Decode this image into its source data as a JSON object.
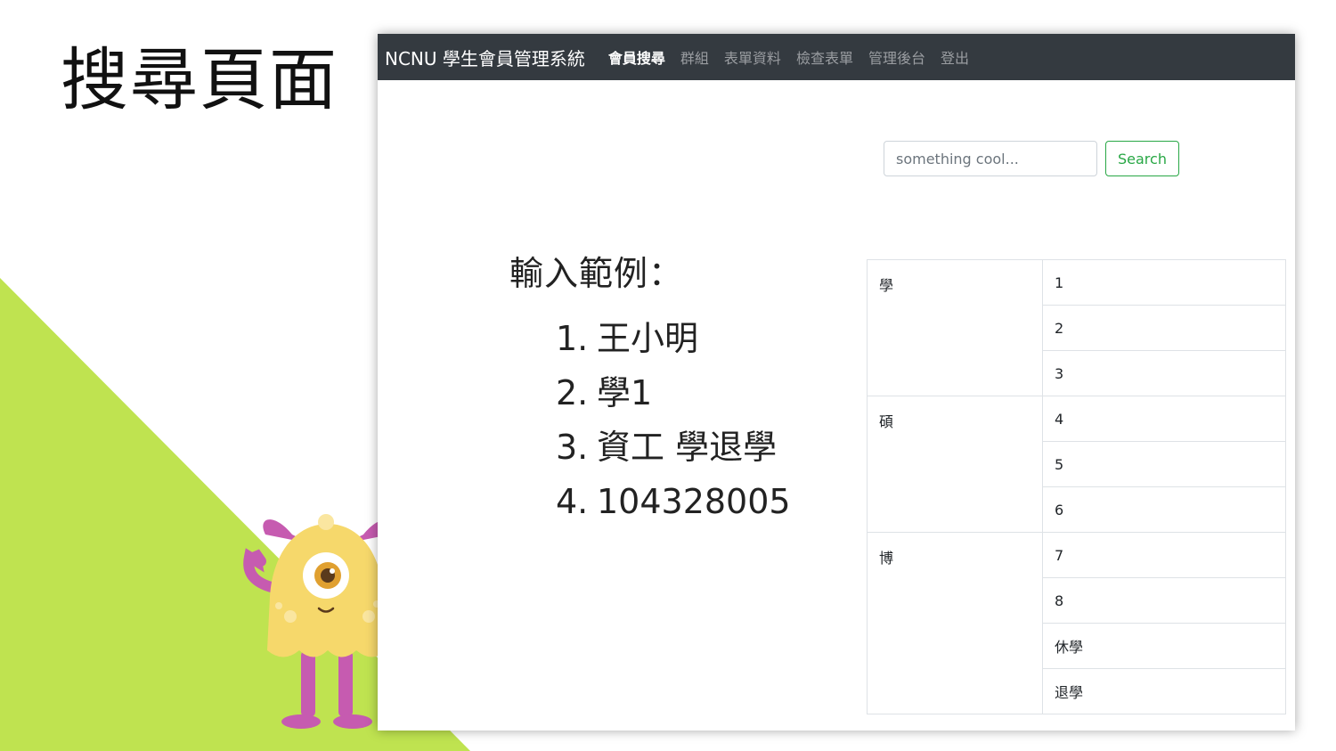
{
  "slide": {
    "title": "搜尋頁面",
    "accent_color": "#bfe350"
  },
  "navbar": {
    "brand": "NCNU 學生會員管理系統",
    "links": [
      {
        "label": "會員搜尋",
        "active": true
      },
      {
        "label": "群組",
        "active": false
      },
      {
        "label": "表單資料",
        "active": false
      },
      {
        "label": "檢查表單",
        "active": false
      },
      {
        "label": "管理後台",
        "active": false
      },
      {
        "label": "登出",
        "active": false
      }
    ]
  },
  "search": {
    "placeholder": "something cool...",
    "button_label": "Search"
  },
  "examples": {
    "heading": "輸入範例：",
    "items": [
      {
        "num": "1.",
        "text": "王小明"
      },
      {
        "num": "2.",
        "text": "學1"
      },
      {
        "num": "3.",
        "text": "資工 學退學"
      },
      {
        "num": "4.",
        "text": "104328005"
      }
    ]
  },
  "table": {
    "groups": [
      {
        "category": "學",
        "values": [
          "1",
          "2",
          "3"
        ]
      },
      {
        "category": "碩",
        "values": [
          "4",
          "5",
          "6"
        ]
      },
      {
        "category": "博",
        "values": [
          "7",
          "8",
          "休學",
          "退學"
        ]
      }
    ]
  },
  "icons": {
    "mascot": "monster-mascot-illustration"
  }
}
